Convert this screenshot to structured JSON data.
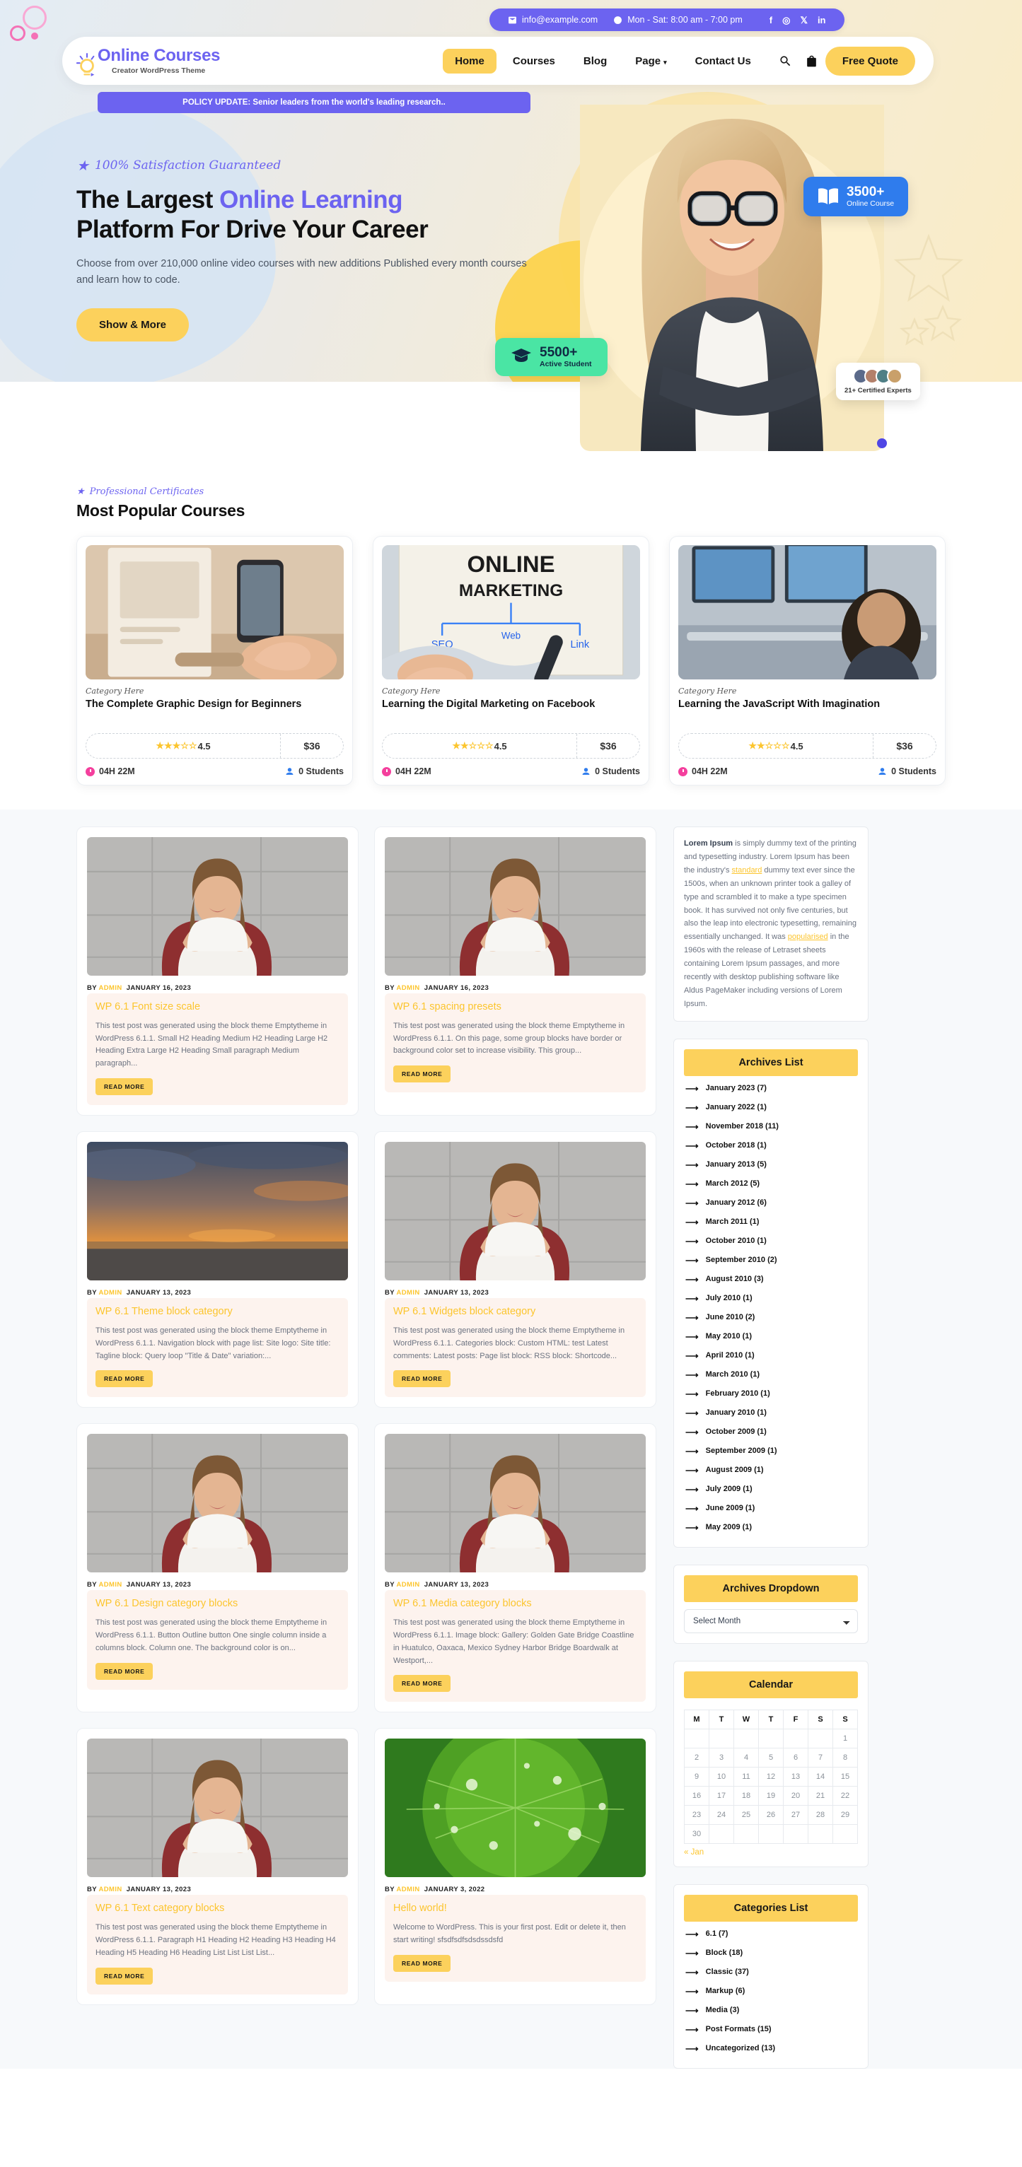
{
  "topbar": {
    "email": "info@example.com",
    "hours": "Mon - Sat: 8:00 am - 7:00 pm",
    "socials": [
      "f",
      "◎",
      "𝕏",
      "in"
    ]
  },
  "header": {
    "brand": "Online Courses",
    "tagline": "Creator WordPress Theme",
    "nav": [
      {
        "label": "Home",
        "active": true
      },
      {
        "label": "Courses",
        "active": false
      },
      {
        "label": "Blog",
        "active": false
      },
      {
        "label": "Page",
        "active": false,
        "caret": true
      },
      {
        "label": "Contact Us",
        "active": false
      }
    ],
    "quote_label": "Free Quote"
  },
  "policy": "POLICY UPDATE: Senior leaders from the world's leading research..",
  "hero": {
    "eyebrow": "100% Satisfaction Guaranteed",
    "title_1": "The Largest ",
    "title_hl": "Online Learning",
    "title_2": "Platform For Drive Your Career",
    "subtitle": "Choose from over 210,000 online video courses with new additions Published every month courses and learn how to code.",
    "cta": "Show & More",
    "badge_course_num": "3500+",
    "badge_course_label": "Online Course",
    "badge_student_num": "5500+",
    "badge_student_label": "Active Student",
    "badge_experts_label": "21+ Certified Experts"
  },
  "courses_section": {
    "eyebrow": "Professional Certificates",
    "title": "Most Popular Courses",
    "cards": [
      {
        "category": "Category Here",
        "title": "The Complete Graphic Design for Beginners",
        "rating": "4.5",
        "price": "$36",
        "duration": "04H 22M",
        "students": "0 Students"
      },
      {
        "category": "Category Here",
        "title": "Learning the Digital Marketing on Facebook",
        "rating": "4.5",
        "price": "$36",
        "duration": "04H 22M",
        "students": "0 Students"
      },
      {
        "category": "Category Here",
        "title": "Learning the JavaScript With Imagination",
        "rating": "4.5",
        "price": "$36",
        "duration": "04H 22M",
        "students": "0 Students"
      }
    ]
  },
  "posts": [
    {
      "by_prefix": "BY",
      "author": "ADMIN",
      "date": "JANUARY 16, 2023",
      "title": "WP 6.1 Font size scale",
      "excerpt": "This test post was generated using the block theme Emptytheme in WordPress 6.1.1. Small H2 Heading Medium H2 Heading Large H2 Heading Extra Large H2 Heading Small paragraph Medium paragraph...",
      "read_more": "READ MORE",
      "thumb": "woman-red-chair"
    },
    {
      "by_prefix": "BY",
      "author": "ADMIN",
      "date": "JANUARY 16, 2023",
      "title": "WP 6.1 spacing presets",
      "excerpt": "This test post was generated using the block theme Emptytheme in WordPress 6.1.1. On this page, some group blocks have border or background color set to increase visibility. This group...",
      "read_more": "READ MORE",
      "thumb": "woman-red-chair"
    },
    {
      "by_prefix": "BY",
      "author": "ADMIN",
      "date": "JANUARY 13, 2023",
      "title": "WP 6.1 Theme block category",
      "excerpt": "This test post was generated using the block theme Emptytheme in WordPress 6.1.1. Navigation block with page list: Site logo: Site title: Tagline block: Query loop \"Title & Date\" variation:...",
      "read_more": "READ MORE",
      "thumb": "sunset-sea"
    },
    {
      "by_prefix": "BY",
      "author": "ADMIN",
      "date": "JANUARY 13, 2023",
      "title": "WP 6.1 Widgets block category",
      "excerpt": "This test post was generated using the block theme Emptytheme in WordPress 6.1.1. Categories block: Custom HTML: test Latest comments: Latest posts: Page list block: RSS block: Shortcode...",
      "read_more": "READ MORE",
      "thumb": "woman-red-chair"
    },
    {
      "by_prefix": "BY",
      "author": "ADMIN",
      "date": "JANUARY 13, 2023",
      "title": "WP 6.1 Design category blocks",
      "excerpt": "This test post was generated using the block theme Emptytheme in WordPress 6.1.1. Button Outline button One single column inside a columns block. Column one. The background color is on...",
      "read_more": "READ MORE",
      "thumb": "woman-red-chair"
    },
    {
      "by_prefix": "BY",
      "author": "ADMIN",
      "date": "JANUARY 13, 2023",
      "title": "WP 6.1 Media category blocks",
      "excerpt": "This test post was generated using the block theme Emptytheme in WordPress 6.1.1. Image block: Gallery: Golden Gate Bridge Coastline in Huatulco, Oaxaca, Mexico Sydney Harbor Bridge Boardwalk at Westport,...",
      "read_more": "READ MORE",
      "thumb": "woman-red-chair"
    },
    {
      "by_prefix": "BY",
      "author": "ADMIN",
      "date": "JANUARY 13, 2023",
      "title": "WP 6.1 Text category blocks",
      "excerpt": "This test post was generated using the block theme Emptytheme in WordPress 6.1.1. Paragraph H1 Heading H2 Heading H3 Heading H4 Heading H5 Heading H6 Heading List List List List...",
      "read_more": "READ MORE",
      "thumb": "woman-red-chair"
    },
    {
      "by_prefix": "BY",
      "author": "ADMIN",
      "date": "JANUARY 3, 2022",
      "title": "Hello world!",
      "excerpt": "Welcome to WordPress. This is your first post. Edit or delete it, then start writing! sfsdfsdfsdsdssdsfd",
      "read_more": "READ MORE",
      "thumb": "green-leaf"
    }
  ],
  "sidebar": {
    "about_text_lead": "Lorem Ipsum",
    "about_p1": " is simply dummy text of the printing and typesetting industry. Lorem Ipsum has been the industry's ",
    "about_link1": "standard",
    "about_p2": " dummy text ever since the 1500s, when an unknown printer took a galley of type and scrambled it to make a type specimen book. It has survived not only five centuries, but also the leap into electronic typesetting, remaining essentially unchanged. It was ",
    "about_link2": "popularised",
    "about_p3": " in the 1960s with the release of Letraset sheets containing Lorem Ipsum passages, and more recently with desktop publishing software like Aldus PageMaker including versions of Lorem Ipsum.",
    "archives_title": "Archives List",
    "archives": [
      "January 2023 (7)",
      "January 2022 (1)",
      "November 2018 (11)",
      "October 2018 (1)",
      "January 2013 (5)",
      "March 2012 (5)",
      "January 2012 (6)",
      "March 2011 (1)",
      "October 2010 (1)",
      "September 2010 (2)",
      "August 2010 (3)",
      "July 2010 (1)",
      "June 2010 (2)",
      "May 2010 (1)",
      "April 2010 (1)",
      "March 2010 (1)",
      "February 2010 (1)",
      "January 2010 (1)",
      "October 2009 (1)",
      "September 2009 (1)",
      "August 2009 (1)",
      "July 2009 (1)",
      "June 2009 (1)",
      "May 2009 (1)"
    ],
    "dropdown_title": "Archives Dropdown",
    "dropdown_value": "Select Month",
    "calendar_title": "Calendar",
    "calendar_head": [
      "M",
      "T",
      "W",
      "T",
      "F",
      "S",
      "S"
    ],
    "calendar_weeks": [
      [
        "",
        "",
        "",
        "",
        "",
        "",
        "1"
      ],
      [
        "2",
        "3",
        "4",
        "5",
        "6",
        "7",
        "8"
      ],
      [
        "9",
        "10",
        "11",
        "12",
        "13",
        "14",
        "15"
      ],
      [
        "16",
        "17",
        "18",
        "19",
        "20",
        "21",
        "22"
      ],
      [
        "23",
        "24",
        "25",
        "26",
        "27",
        "28",
        "29"
      ],
      [
        "30",
        "",
        "",
        "",
        "",
        "",
        ""
      ]
    ],
    "calendar_nav": "« Jan",
    "categories_title": "Categories List",
    "categories": [
      "6.1 (7)",
      "Block (18)",
      "Classic (37)",
      "Markup (6)",
      "Media (3)",
      "Post Formats (15)",
      "Uncategorized (13)"
    ]
  },
  "colors": {
    "purple": "#6c63f0",
    "yellow": "#fcd15c",
    "blue": "#2f7ced",
    "green": "#4ae5a4",
    "pink": "#f43f9d"
  }
}
